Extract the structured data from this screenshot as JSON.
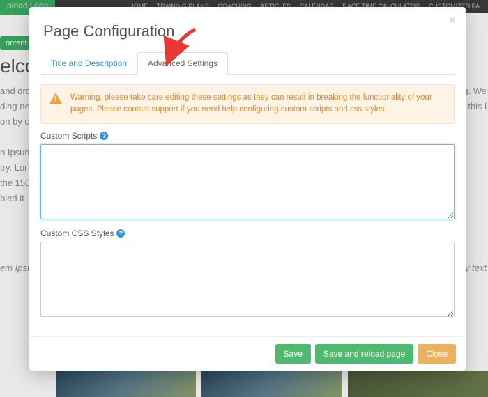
{
  "background": {
    "logo_text": "pload Logo",
    "nav": [
      "HOME",
      "TRAINING PLANS",
      "COACHING",
      "ARTICLES",
      "CALENDAR",
      "RACE TIME CALCULATOR",
      "CUSTOMIZED PA"
    ],
    "content_btn": "ontent",
    "heading_fragment": "elco",
    "line1": "and dro",
    "line2": "ding ne",
    "line3": "on by cl",
    "line_r1": "g. We",
    "line_r2": "e this l",
    "lorem1": "n Ipsum",
    "lorem2": "try. Lor",
    "lorem3": " the 150",
    "lorem4": "bled it",
    "lorem5": "em Ipsu",
    "lorem_r": "y text"
  },
  "modal": {
    "title": "Page Configuration",
    "tabs": {
      "title_desc": "Title and Description",
      "advanced": "Advanced Settings"
    },
    "alert": "Warning, please take care editing these settings as they can result in breaking the functionality of your pages. Please contact support if you need help configuring custom scripts and css styles.",
    "custom_scripts_label": "Custom Scripts",
    "custom_scripts_value": "",
    "custom_css_label": "Custom CSS Styles",
    "custom_css_value": "",
    "buttons": {
      "save": "Save",
      "save_reload": "Save and reload page",
      "close": "Close"
    }
  }
}
